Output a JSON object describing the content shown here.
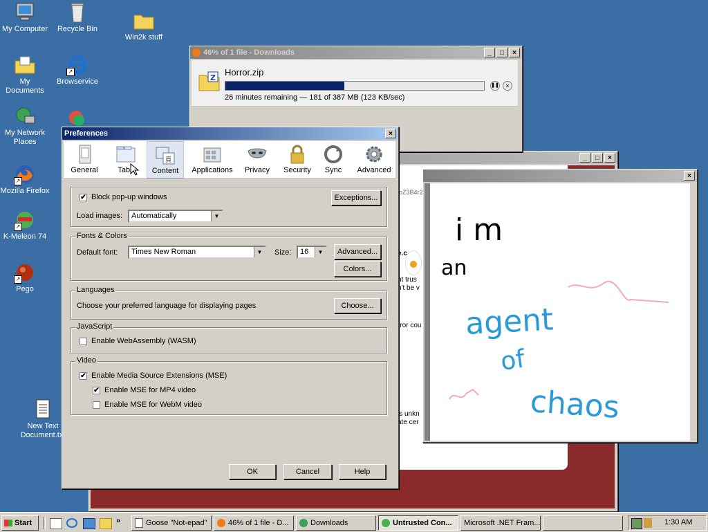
{
  "desktop": {
    "icons": [
      {
        "label": "My Computer"
      },
      {
        "label": "Recycle Bin"
      },
      {
        "label": "Win2k stuff"
      },
      {
        "label": "My Documents"
      },
      {
        "label": "Browservice"
      },
      {
        "label": "My Network Places"
      },
      {
        "label": "Mozilla Firefox"
      },
      {
        "label": "K-Meleon 74"
      },
      {
        "label": "Pego"
      },
      {
        "label": "New Text Document.txt"
      }
    ]
  },
  "downloads": {
    "title": "46% of 1 file - Downloads",
    "file": "Horror.zip",
    "progress": 0.46,
    "status": "26 minutes remaining — 181 of 387 MB (123 KB/sec)"
  },
  "bgwindow": {
    "partial_text": [
      "oZ3B4r2",
      "e.c",
      "nt trus",
      "n't be v",
      "rror cou",
      "is unkn",
      "ate cer"
    ]
  },
  "paint": {
    "words": [
      "i m",
      "an",
      "agent",
      "of",
      "chaos"
    ],
    "colors": {
      "black": "#000000",
      "blue": "#2b9ad8",
      "pink": "#f5a6c0"
    }
  },
  "prefs": {
    "title": "Preferences",
    "panes": [
      {
        "label": "General",
        "icon": "general-icon"
      },
      {
        "label": "Tabs",
        "icon": "tabs-icon"
      },
      {
        "label": "Content",
        "icon": "content-icon"
      },
      {
        "label": "Applications",
        "icon": "applications-icon"
      },
      {
        "label": "Privacy",
        "icon": "privacy-icon"
      },
      {
        "label": "Security",
        "icon": "security-icon"
      },
      {
        "label": "Sync",
        "icon": "sync-icon"
      },
      {
        "label": "Advanced",
        "icon": "advanced-icon"
      }
    ],
    "selected_pane": "Content",
    "popup": {
      "block_label": "Block pop-up windows",
      "block_checked": true,
      "exceptions": "Exceptions...",
      "load_images_label": "Load images:",
      "load_images_value": "Automatically"
    },
    "fonts": {
      "group": "Fonts & Colors",
      "default_font_label": "Default font:",
      "default_font_value": "Times New Roman",
      "size_label": "Size:",
      "size_value": "16",
      "advanced": "Advanced...",
      "colors": "Colors..."
    },
    "languages": {
      "group": "Languages",
      "text": "Choose your preferred language for displaying pages",
      "choose": "Choose..."
    },
    "javascript": {
      "group": "JavaScript",
      "wasm_label": "Enable WebAssembly (WASM)",
      "wasm_checked": false
    },
    "video": {
      "group": "Video",
      "mse_label": "Enable Media Source Extensions (MSE)",
      "mse_checked": true,
      "mp4_label": "Enable MSE for MP4 video",
      "mp4_checked": true,
      "webm_label": "Enable MSE for WebM video",
      "webm_checked": false
    },
    "buttons": {
      "ok": "OK",
      "cancel": "Cancel",
      "help": "Help"
    }
  },
  "taskbar": {
    "start": "Start",
    "items": [
      {
        "label": "Goose \"Not-epad\""
      },
      {
        "label": "46% of 1 file - D..."
      },
      {
        "label": "Downloads"
      },
      {
        "label": "Untrusted Con..."
      },
      {
        "label": "Microsoft .NET Fram..."
      }
    ],
    "clock": "1:30 AM"
  }
}
